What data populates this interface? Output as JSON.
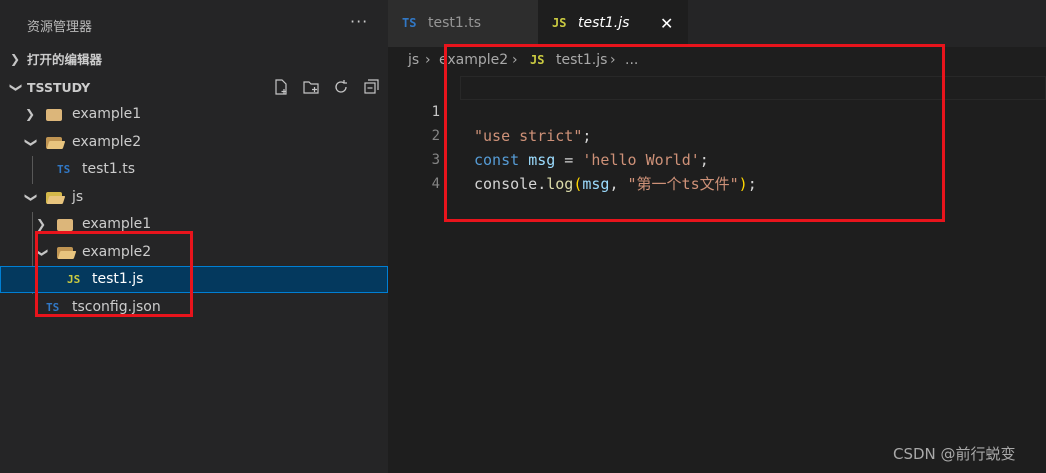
{
  "sidebar": {
    "title": "资源管理器",
    "more": "···",
    "open_editors": "打开的编辑器",
    "project": "TSSTUDY",
    "tree": [
      {
        "label": "example1",
        "type": "folder",
        "expanded": false,
        "depth": 1
      },
      {
        "label": "example2",
        "type": "folder",
        "expanded": true,
        "depth": 1
      },
      {
        "label": "test1.ts",
        "type": "ts",
        "depth": 2
      },
      {
        "label": "js",
        "type": "folder-js",
        "expanded": true,
        "depth": 1
      },
      {
        "label": "example1",
        "type": "folder",
        "expanded": false,
        "depth": 2
      },
      {
        "label": "example2",
        "type": "folder",
        "expanded": true,
        "depth": 2
      },
      {
        "label": "test1.js",
        "type": "js",
        "depth": 3,
        "selected": true
      },
      {
        "label": "tsconfig.json",
        "type": "tsconfig",
        "depth": 1
      }
    ],
    "badges": {
      "ts": "TS",
      "js": "JS"
    }
  },
  "tabs": [
    {
      "badge": "TS",
      "label": "test1.ts",
      "active": false
    },
    {
      "badge": "JS",
      "label": "test1.js",
      "active": true,
      "close": "✕"
    }
  ],
  "breadcrumb": {
    "items": [
      "js",
      "example2",
      "JS",
      "test1.js",
      "..."
    ],
    "sep": "›"
  },
  "code": {
    "line_numbers": [
      "1",
      "2",
      "3",
      "4"
    ],
    "line1": {
      "str": "\"use strict\"",
      "semi": ";"
    },
    "line2": {
      "kw": "const",
      "var": "msg",
      "eq": " = ",
      "str": "'hello World'",
      "semi": ";"
    },
    "line3": {
      "obj": "console",
      "dot": ".",
      "fn": "log",
      "open": "(",
      "arg": "msg",
      "comma": ", ",
      "str": "\"第一个ts文件\"",
      "close": ")",
      "semi": ";"
    }
  },
  "watermark": "CSDN @前行蜕变",
  "colors": {
    "annotation": "#e8141c",
    "selection": "#04395e",
    "ts": "#3178c6",
    "js": "#cbcb41"
  }
}
